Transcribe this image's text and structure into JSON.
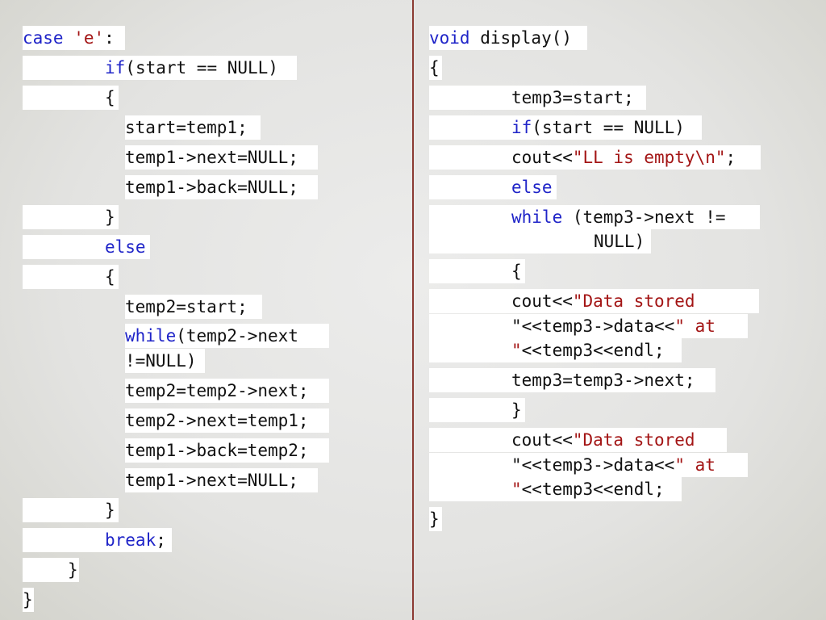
{
  "left_code": [
    [
      {
        "t": "case ",
        "c": "kw"
      },
      {
        "t": "'e'",
        "c": "str"
      },
      {
        "t": ":",
        "c": ""
      }
    ],
    [
      {
        "t": "if",
        "c": "kw"
      },
      {
        "t": "(start == NULL)",
        "c": ""
      }
    ],
    [
      {
        "t": "{",
        "c": ""
      }
    ],
    [
      {
        "t": "start=temp1;",
        "c": ""
      }
    ],
    [
      {
        "t": "temp1->next=NULL;",
        "c": ""
      }
    ],
    [
      {
        "t": "temp1->back=NULL;",
        "c": ""
      }
    ],
    [
      {
        "t": "}",
        "c": ""
      }
    ],
    [
      {
        "t": "else",
        "c": "kw"
      }
    ],
    [
      {
        "t": "{",
        "c": ""
      }
    ],
    [
      {
        "t": "temp2=start;",
        "c": ""
      }
    ],
    [
      {
        "t": "while",
        "c": "kw"
      },
      {
        "t": "(temp2->next",
        "c": ""
      }
    ],
    [
      {
        "t": "!=NULL)",
        "c": ""
      }
    ],
    [
      {
        "t": "temp2=temp2->next;",
        "c": ""
      }
    ],
    [
      {
        "t": "temp2->next=temp1;",
        "c": ""
      }
    ],
    [
      {
        "t": "temp1->back=temp2;",
        "c": ""
      }
    ],
    [
      {
        "t": "temp1->next=NULL;",
        "c": ""
      }
    ],
    [
      {
        "t": "}",
        "c": ""
      }
    ],
    [
      {
        "t": "break",
        "c": "kw"
      },
      {
        "t": ";",
        "c": ""
      }
    ],
    [
      {
        "t": "}",
        "c": ""
      }
    ],
    [
      {
        "t": "}",
        "c": ""
      }
    ]
  ],
  "right_code": [
    [
      {
        "t": "void ",
        "c": "kw"
      },
      {
        "t": "display()",
        "c": ""
      }
    ],
    [
      {
        "t": "{",
        "c": ""
      }
    ],
    [
      {
        "t": "temp3=start;",
        "c": ""
      }
    ],
    [
      {
        "t": "if",
        "c": "kw"
      },
      {
        "t": "(start == NULL)",
        "c": ""
      }
    ],
    [
      {
        "t": "cout<<",
        "c": ""
      },
      {
        "t": "\"LL is empty\\n\"",
        "c": "str"
      },
      {
        "t": ";",
        "c": ""
      }
    ],
    [
      {
        "t": "else",
        "c": "kw"
      }
    ],
    [
      {
        "t": "while ",
        "c": "kw"
      },
      {
        "t": "(temp3->next !=",
        "c": ""
      }
    ],
    [
      {
        "t": "NULL)",
        "c": ""
      }
    ],
    [
      {
        "t": "{",
        "c": ""
      }
    ],
    [
      {
        "t": "cout<<",
        "c": ""
      },
      {
        "t": "\"Data stored ",
        "c": "str"
      }
    ],
    [
      {
        "t": "\"",
        "c": ""
      },
      {
        "t": "<<temp3->data<<",
        "c": ""
      },
      {
        "t": "\" at ",
        "c": "str"
      }
    ],
    [
      {
        "t": "\"",
        "c": "str"
      },
      {
        "t": "<<temp3<<endl;",
        "c": ""
      }
    ],
    [
      {
        "t": "temp3=temp3->next;",
        "c": ""
      }
    ],
    [
      {
        "t": "}",
        "c": ""
      }
    ],
    [
      {
        "t": "cout<<",
        "c": ""
      },
      {
        "t": "\"Data stored ",
        "c": "str"
      }
    ],
    [
      {
        "t": "\"",
        "c": ""
      },
      {
        "t": "<<temp3->data<<",
        "c": ""
      },
      {
        "t": "\" at ",
        "c": "str"
      }
    ],
    [
      {
        "t": "\"",
        "c": "str"
      },
      {
        "t": "<<temp3<<endl;",
        "c": ""
      }
    ],
    [
      {
        "t": "}",
        "c": ""
      }
    ]
  ]
}
